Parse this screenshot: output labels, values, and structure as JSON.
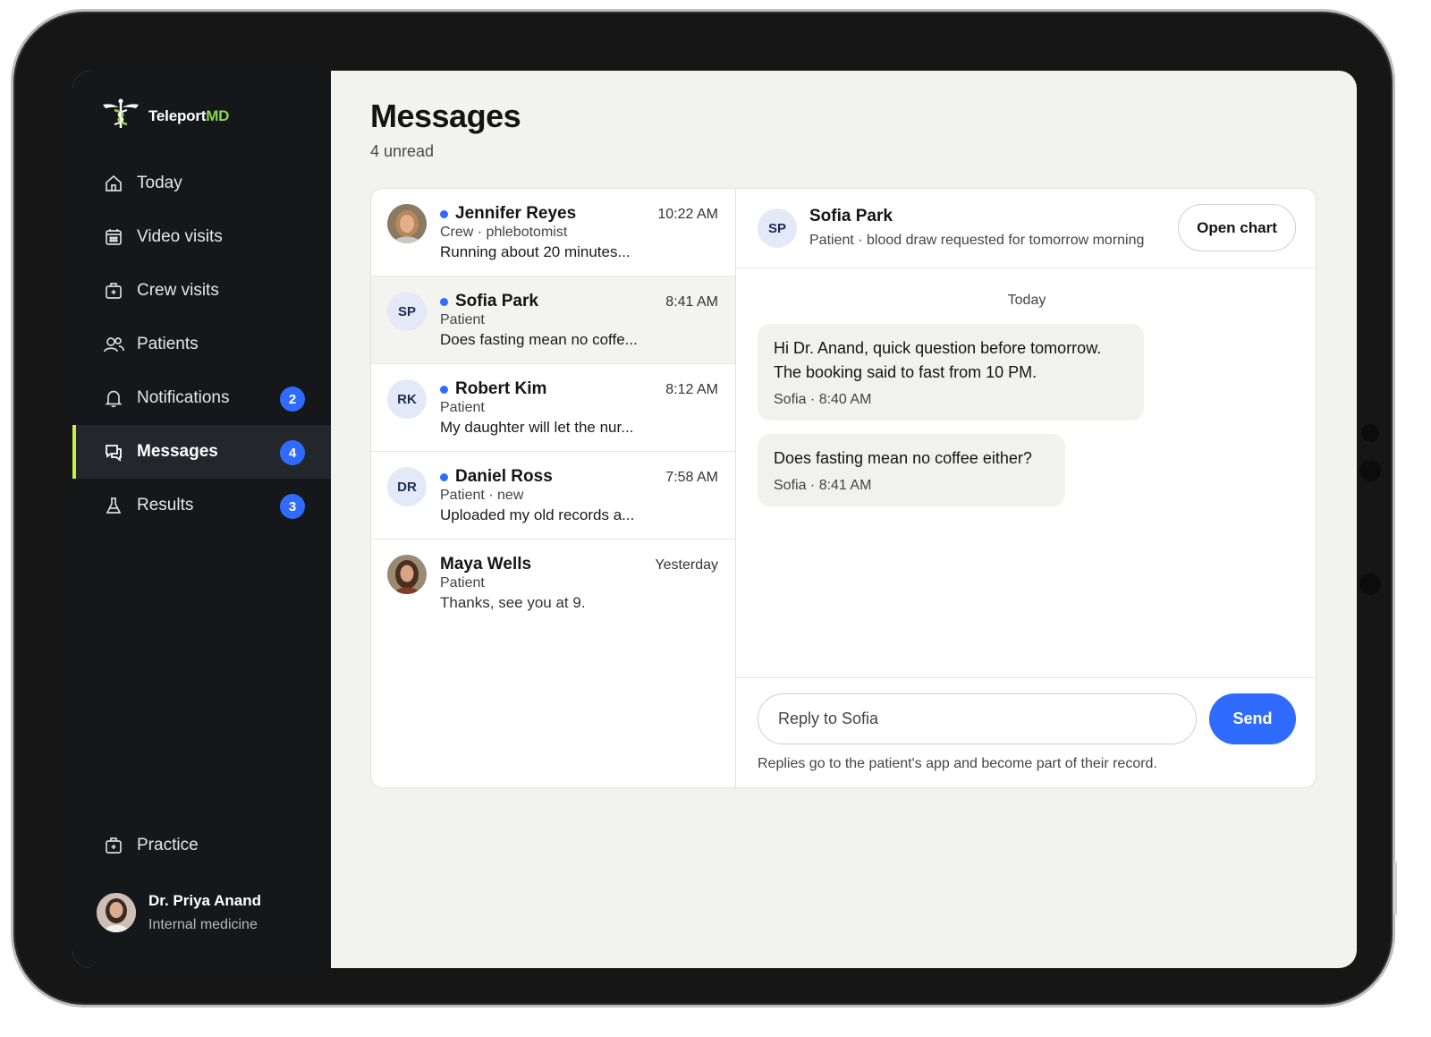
{
  "app": {
    "name_main": "Teleport",
    "name_accent": "MD"
  },
  "sidebar": {
    "items": [
      {
        "label": "Today",
        "icon": "home-icon"
      },
      {
        "label": "Video visits",
        "icon": "calendar-icon"
      },
      {
        "label": "Crew visits",
        "icon": "medical-bag-icon"
      },
      {
        "label": "Patients",
        "icon": "users-icon"
      },
      {
        "label": "Notifications",
        "icon": "bell-icon",
        "badge": "2"
      },
      {
        "label": "Messages",
        "icon": "chat-icon",
        "badge": "4",
        "active": true
      },
      {
        "label": "Results",
        "icon": "flask-icon",
        "badge": "3"
      }
    ],
    "practice_label": "Practice",
    "profile": {
      "name": "Dr. Priya Anand",
      "role": "Internal medicine"
    }
  },
  "page": {
    "title": "Messages",
    "unread": "4 unread"
  },
  "conversations": [
    {
      "initials": "",
      "photo": true,
      "name": "Jennifer Reyes",
      "unread": true,
      "time": "10:22 AM",
      "role": "Crew · phlebotomist",
      "preview": "Running about 20 minutes..."
    },
    {
      "initials": "SP",
      "name": "Sofia Park",
      "unread": true,
      "time": "8:41 AM",
      "role": "Patient",
      "preview": "Does fasting mean no coffe...",
      "selected": true
    },
    {
      "initials": "RK",
      "name": "Robert Kim",
      "unread": true,
      "time": "8:12 AM",
      "role": "Patient",
      "preview": "My daughter will let the nur..."
    },
    {
      "initials": "DR",
      "name": "Daniel Ross",
      "unread": true,
      "time": "7:58 AM",
      "role": "Patient · new",
      "preview": "Uploaded my old records a..."
    },
    {
      "initials": "",
      "photo": true,
      "name": "Maya Wells",
      "unread": false,
      "time": "Yesterday",
      "role": "Patient",
      "preview": "Thanks, see you at 9."
    }
  ],
  "thread": {
    "initials": "SP",
    "name": "Sofia Park",
    "subtitle": "Patient · blood draw requested for tomorrow morning",
    "open_chart_label": "Open chart",
    "day_label": "Today",
    "messages": [
      {
        "line1": "Hi Dr. Anand, quick question before tomorrow.",
        "line2": "The booking said to fast from 10 PM.",
        "meta": "Sofia · 8:40 AM"
      },
      {
        "line1": "Does fasting mean no coffee either?",
        "meta": "Sofia · 8:41 AM"
      }
    ],
    "reply_placeholder": "Reply to Sofia",
    "send_label": "Send",
    "hint": "Replies go to the patient's app and become part of their record."
  },
  "colors": {
    "accent": "#2f6bff",
    "active_bar": "#c8f04a",
    "sidebar_bg": "#15171a",
    "logo_accent": "#8bd44a"
  }
}
